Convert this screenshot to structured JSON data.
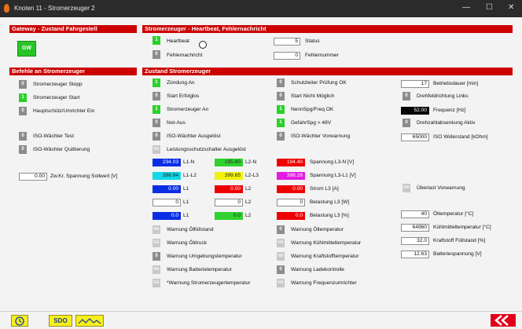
{
  "window": {
    "title": "Knoten 11 - Stromerzeuger 2",
    "minimize": "—",
    "maximize": "☐",
    "close": "✕"
  },
  "sections": {
    "gateway": "Gateway - Zustand Fahrgestell",
    "heartbeat": "Stromerzeuger - Heartbeat, Fehlernachricht",
    "befehle": "Befehle an Stromerzeuger",
    "zustand": "Zustand Stromerzeuger"
  },
  "gateway": {
    "button": "GW"
  },
  "heartbeat": {
    "hb_ind": "1",
    "hb_label": "Heartbeat",
    "err_ind": "0",
    "err_label": "Fehlernachricht",
    "status_value": "5",
    "status_label": "Status",
    "fnum_value": "0",
    "fnum_label": "Fehlernummer"
  },
  "befehle": {
    "stopp_ind": "0",
    "stopp": "Stromerzeuger Stopp",
    "start_ind": "1",
    "start": "Stromerzeuger Start",
    "haupt_ind": "0",
    "haupt": "Hauptschütz/Umrichter Ein",
    "iso_test_ind": "0",
    "iso_test": "ISO-Wächter Test",
    "iso_quit_ind": "0",
    "iso_quit": "ISO-Wächter Quittierung",
    "sollwert_value": "0.00",
    "sollwert_label": "Zw.Kr. Spannung Sollwert [V]"
  },
  "col1": {
    "zuendung_ind": "1",
    "zuendung": "Zündung An",
    "start_erf_ind": "0",
    "start_erf": "Start Erfolglos",
    "se_an_ind": "1",
    "se_an": "Stromerzeuger An",
    "notaus_ind": "0",
    "notaus": "Not-Aus",
    "iso_ausg_ind": "0",
    "iso_ausg": "ISO-Wächter Ausgelöst",
    "lss_ind": "NA",
    "lss": "Leistungsschutzschalter Ausgelöst"
  },
  "grid": {
    "r1v1": "234.03",
    "r1l1": "L1-N",
    "r1v2": "195.60",
    "r1l2": "L2-N",
    "r2v1": "398.94",
    "r2l1": "L1-L2",
    "r2v2": "399.65",
    "r2l2": "L2-L3",
    "r3v1": "0.00",
    "r3l1": "L1",
    "r3v2": "0.00",
    "r3l2": "L2",
    "r4v1": "0",
    "r4l1": "L1",
    "r4v2": "0",
    "r4l2": "L2",
    "r5v1": "0.0",
    "r5l1": "L1",
    "r5v2": "0.0",
    "r5l2": "L2"
  },
  "col3": {
    "r1_value": "194.40",
    "r1_label": "Spannung L3-N [V]",
    "r2_value": "398.28",
    "r2_label": "Spannung L3-L1 [V]",
    "r3_value": "0.00",
    "r3_label": "Strom L3 [A]",
    "r4_value": "0",
    "r4_label": "Belastung L3 [W]",
    "r5_value": "0.0",
    "r5_label": "Belastung L3 [%]"
  },
  "col2": {
    "schutz_ind": "0",
    "schutz": "Schutzleiter Prüfung OK",
    "start_nm_ind": "0",
    "start_nm": "Start Nicht Möglich",
    "nenn_ind": "1",
    "nenn": "NennSpg/Freq OK",
    "gef_ind": "1",
    "gef": "GefahrSpg > 48V",
    "iso_vorw_ind": "0",
    "iso_vorw": "ISO-Wächter Vorwarnung"
  },
  "col4": {
    "betrieb_value": "17",
    "betrieb_label": "Betriebsdauer [min]",
    "drehfeld_ind": "0",
    "drehfeld": "Drehfeldrichtung Links",
    "freq_value": "52.00",
    "freq_label": "Frequenz [Hz]",
    "drehzahl_ind": "0",
    "drehzahl": "Drehzahlabsenkung Aktiv",
    "iso_wid_value": "65000",
    "iso_wid_label": "ISO Widerstand [kOhm]",
    "ueberlast_ind": "NA",
    "ueberlast": "Überlast Vorwarnung"
  },
  "warn_left": {
    "oelstand_ind": "NA",
    "oelstand": "Warnung Ölfüllstand",
    "oeldruck_ind": "NA",
    "oeldruck": "Warnung Öldruck",
    "umgeb_ind": "0",
    "umgeb": "Warnung Umgebungstemperatur",
    "batt_ind": "NA",
    "batt": "Warnung Batterietemperatur",
    "setemp_ind": "NA",
    "setemp": "*Warnung Stromerzeugertemperatur"
  },
  "warn_mid": {
    "oeltemp_ind": "0",
    "oeltemp": "Warnung Öltemperatur",
    "kuehl_ind": "NA",
    "kuehl": "Warnung Kühlmitteltemperatur",
    "kraft_ind": "NA",
    "kraft": "Warnung Kraftstofftemperatur",
    "lade_ind": "0",
    "lade": "Warnung Ladekontrolle",
    "freq_ind": "NA",
    "freq": "Warnung Frequenzumrichter"
  },
  "temps": {
    "oel_value": "40",
    "oel_label": "Öltemperatur [°C]",
    "kuehl_value": "64960",
    "kuehl_label": "Kühlmitteltemperatur [°C]",
    "kraft_value": "32.0",
    "kraft_label": "Kraftstoff Füllstand [%]",
    "batt_value": "12.63",
    "batt_label": "Batteriespannung [V]"
  },
  "bottom": {
    "clock_icon": "clock-icon",
    "sdo": "SDO",
    "chart_icon": "chart-icon",
    "back_icon": "back-arrow-icon"
  }
}
